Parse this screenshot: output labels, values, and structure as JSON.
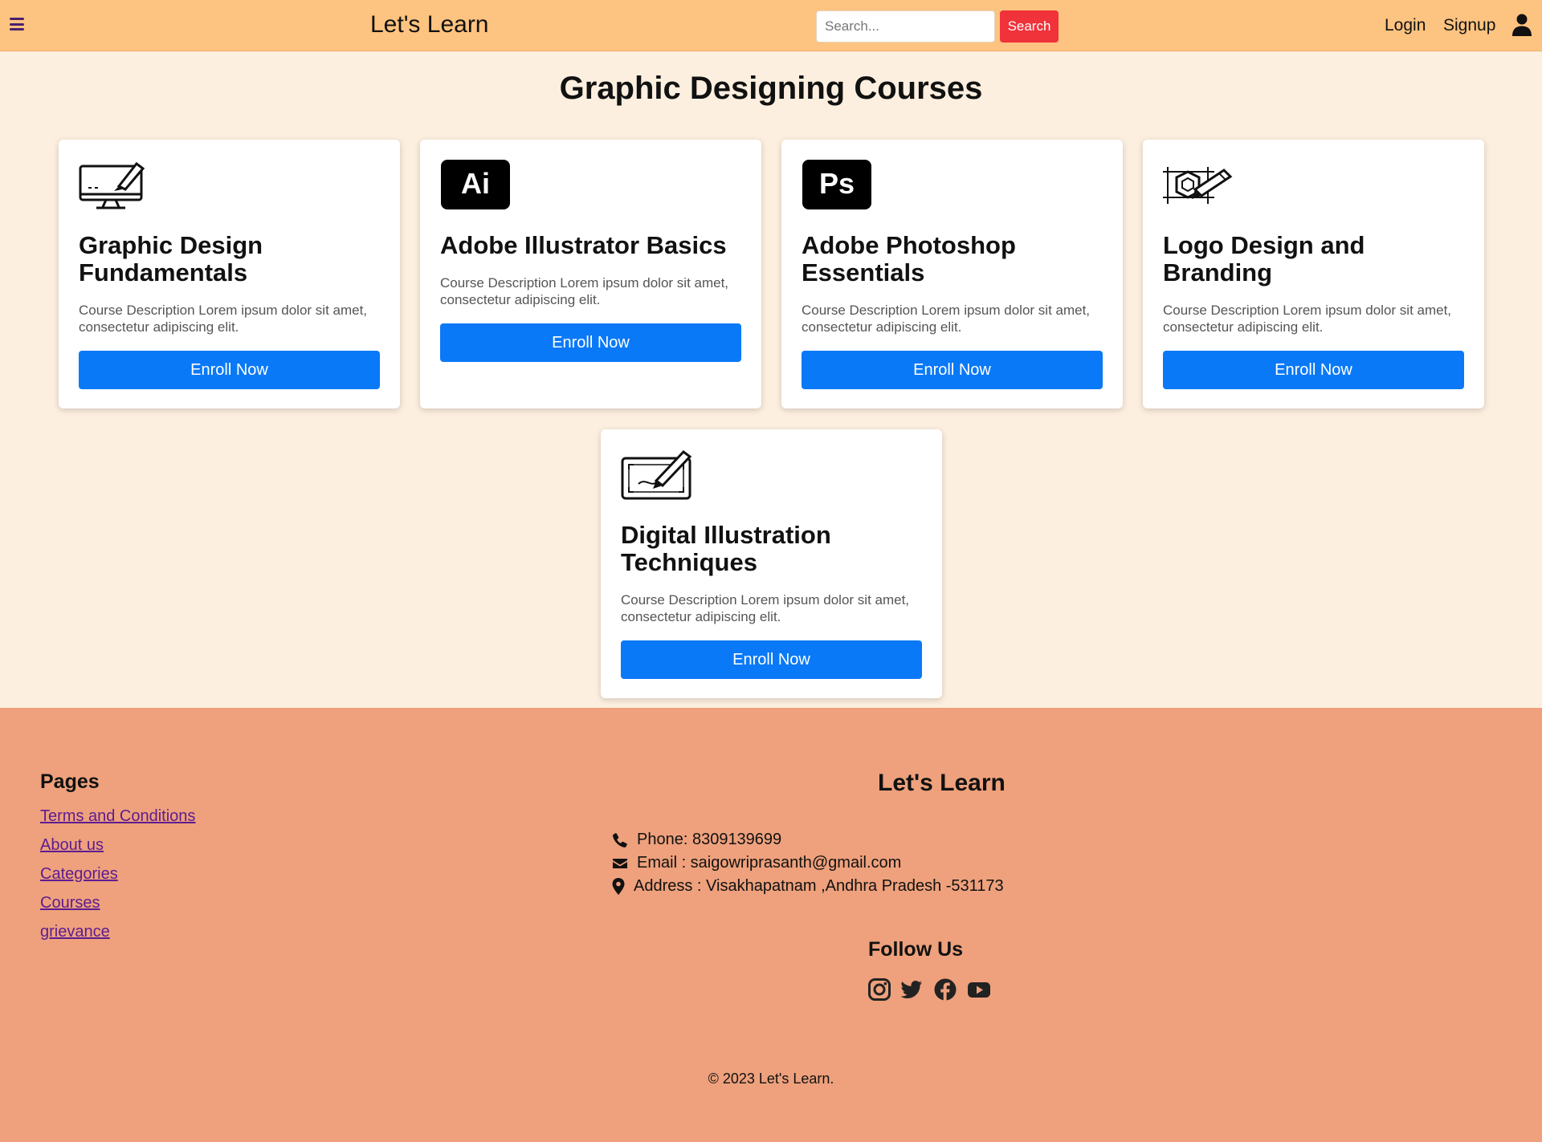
{
  "header": {
    "brand": "Let's Learn",
    "search_placeholder": "Search...",
    "search_button": "Search",
    "login": "Login",
    "signup": "Signup",
    "menu_icon": "hamburger-menu-icon",
    "user_icon": "user-icon"
  },
  "main": {
    "title": "Graphic Designing Courses",
    "courses": [
      {
        "title": "Graphic Design Fundamentals",
        "description": "Course Description Lorem ipsum dolor sit amet, consectetur adipiscing elit.",
        "button": "Enroll Now",
        "icon": "monitor-design-icon"
      },
      {
        "title": "Adobe Illustrator Basics",
        "description": "Course Description Lorem ipsum dolor sit amet, consectetur adipiscing elit.",
        "button": "Enroll Now",
        "icon": "illustrator-icon",
        "icon_text": "Ai"
      },
      {
        "title": "Adobe Photoshop Essentials",
        "description": "Course Description Lorem ipsum dolor sit amet, consectetur adipiscing elit.",
        "button": "Enroll Now",
        "icon": "photoshop-icon",
        "icon_text": "Ps"
      },
      {
        "title": "Logo Design and Branding",
        "description": "Course Description Lorem ipsum dolor sit amet, consectetur adipiscing elit.",
        "button": "Enroll Now",
        "icon": "logo-design-icon"
      },
      {
        "title": "Digital Illustration Techniques",
        "description": "Course Description Lorem ipsum dolor sit amet, consectetur adipiscing elit.",
        "button": "Enroll Now",
        "icon": "drawing-tablet-icon"
      }
    ]
  },
  "footer": {
    "pages_title": "Pages",
    "pages": [
      "Terms and Conditions",
      "About us",
      "Categories",
      "Courses",
      "grievance"
    ],
    "brand": "Let's Learn",
    "phone": "Phone: 8309139699",
    "email": "Email : saigowriprasanth@gmail.com",
    "address": "Address : Visakhapatnam ,Andhra Pradesh -531173",
    "follow_title": "Follow Us",
    "social_icons": [
      "instagram-icon",
      "twitter-icon",
      "facebook-icon",
      "youtube-icon"
    ],
    "copyright": "© 2023 Let's Learn."
  },
  "colors": {
    "header_bg": "#fdc380",
    "page_bg": "#fdefdf",
    "footer_bg": "#eea17c",
    "search_button": "#f0323b",
    "enroll_button": "#0a79f7",
    "link": "#5d1c8f"
  }
}
